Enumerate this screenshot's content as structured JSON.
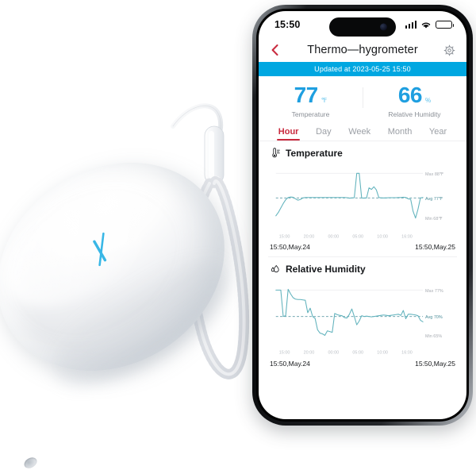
{
  "product": {
    "name": "thermo-hygrometer-sensor",
    "logo_letter": "X",
    "logo_color": "#39b7e6",
    "body_color": "#ffffff",
    "strap_color": "#f2f3f5"
  },
  "phone": {
    "statusbar": {
      "time": "15:50",
      "signal_icon": "cellular-signal-icon",
      "wifi_icon": "wifi-icon",
      "battery_icon": "battery-icon"
    },
    "navbar": {
      "back_icon": "back-chevron-icon",
      "back_color": "#c92a3e",
      "title": "Thermo—hygrometer",
      "settings_icon": "gear-icon"
    },
    "banner": {
      "text": "Updated at 2023-05-25 15:50",
      "background": "#00a7e1",
      "text_color": "#ffffff"
    },
    "readings": [
      {
        "value": "77",
        "unit": "℉",
        "label": "Temperature",
        "color": "#1f9fe0"
      },
      {
        "value": "66",
        "unit": "%",
        "label": "Relative Humidity",
        "color": "#1f9fe0"
      }
    ],
    "tabs": [
      {
        "label": "Hour",
        "active": true
      },
      {
        "label": "Day",
        "active": false
      },
      {
        "label": "Week",
        "active": false
      },
      {
        "label": "Month",
        "active": false
      },
      {
        "label": "Year",
        "active": false
      }
    ],
    "active_tab_color": "#c92a3e"
  },
  "chart_data": [
    {
      "type": "line",
      "title": "Temperature",
      "icon": "thermometer-icon",
      "line_color": "#62b3bd",
      "ylabel": "℉",
      "xlabel": "",
      "ylim": [
        64,
        91
      ],
      "grid": false,
      "legend_position": "right-inline",
      "annotations": [
        {
          "name": "max",
          "label": "Max 88℉",
          "value": 88
        },
        {
          "name": "avg",
          "label": "Avg 77℉",
          "value": 77
        },
        {
          "name": "min",
          "label": "Min 68℉",
          "value": 68
        }
      ],
      "xtick_labels": [
        "15:00",
        "20:00",
        "00:00",
        "05:00",
        "10:00",
        "16:00"
      ],
      "range_start_label": "15:50,May.24",
      "range_end_label": "15:50,May.25",
      "x": [
        0,
        1,
        2,
        3,
        4,
        5,
        6,
        7,
        8,
        9,
        10,
        11,
        12,
        13,
        14,
        15,
        16,
        17,
        18,
        19,
        20,
        21,
        22,
        23,
        24,
        25,
        26,
        27,
        28,
        29,
        30,
        31,
        32,
        33,
        34,
        35,
        36,
        37,
        38,
        39,
        40,
        41,
        42,
        43,
        44,
        45,
        46,
        47,
        48,
        49,
        50,
        51,
        52,
        53,
        54,
        55,
        56,
        57,
        58,
        59,
        60
      ],
      "values": [
        69,
        70.5,
        72.5,
        74.5,
        76.2,
        77.2,
        77.4,
        77.3,
        76.6,
        76.0,
        76.3,
        77.0,
        77.2,
        77.2,
        77.2,
        77.2,
        77.2,
        77.2,
        77.2,
        77.2,
        77.2,
        77.2,
        77.2,
        77.2,
        77.2,
        77.2,
        77.2,
        77.2,
        77.2,
        77.1,
        76.9,
        77.0,
        77.1,
        88.0,
        88.0,
        77.0,
        76.9,
        77.0,
        81.5,
        80.8,
        82.0,
        80.6,
        77.2,
        77.0,
        77.0,
        77.0,
        77.1,
        77.1,
        77.1,
        77.1,
        77.2,
        77.2,
        77.3,
        77.2,
        76.6,
        76.4,
        71.0,
        68.0,
        72.0,
        77.0,
        77.2
      ]
    },
    {
      "type": "line",
      "title": "Relative Humidity",
      "icon": "humidity-drop-icon",
      "line_color": "#62b3bd",
      "ylabel": "%",
      "xlabel": "",
      "ylim": [
        63,
        79
      ],
      "grid": false,
      "legend_position": "right-inline",
      "annotations": [
        {
          "name": "max",
          "label": "Max 77%",
          "value": 77
        },
        {
          "name": "avg",
          "label": "Avg 70%",
          "value": 70
        },
        {
          "name": "min",
          "label": "Min 65%",
          "value": 65
        }
      ],
      "xtick_labels": [
        "15:00",
        "20:00",
        "00:00",
        "05:00",
        "10:00",
        "16:00"
      ],
      "range_start_label": "15:50,May.24",
      "range_end_label": "15:50,May.25",
      "x": [
        0,
        1,
        2,
        3,
        4,
        5,
        6,
        7,
        8,
        9,
        10,
        11,
        12,
        13,
        14,
        15,
        16,
        17,
        18,
        19,
        20,
        21,
        22,
        23,
        24,
        25,
        26,
        27,
        28,
        29,
        30,
        31,
        32,
        33,
        34,
        35,
        36,
        37,
        38,
        39,
        40,
        41,
        42,
        43,
        44,
        45,
        46,
        47,
        48,
        49,
        50,
        51,
        52,
        53,
        54,
        55,
        56,
        57,
        58,
        59,
        60
      ],
      "values": [
        77,
        77,
        77,
        70.0,
        70.2,
        77.2,
        76.0,
        75.0,
        74.6,
        74.5,
        74.5,
        74.4,
        74.3,
        71.0,
        72.2,
        70.0,
        69.5,
        66.5,
        65.6,
        65.4,
        65.0,
        66.2,
        66.0,
        65.8,
        70.8,
        70.5,
        70.3,
        70.2,
        69.7,
        69.6,
        70.6,
        72.0,
        70.0,
        67.8,
        68.8,
        70.2,
        70.0,
        70.1,
        70.0,
        69.9,
        70.0,
        70.1,
        70.2,
        70.3,
        70.4,
        70.3,
        70.2,
        70.3,
        70.4,
        70.5,
        70.6,
        70.3,
        71.6,
        69.4,
        70.6,
        70.6,
        70.5,
        70.4,
        70.2,
        69.0,
        68.6
      ]
    }
  ]
}
